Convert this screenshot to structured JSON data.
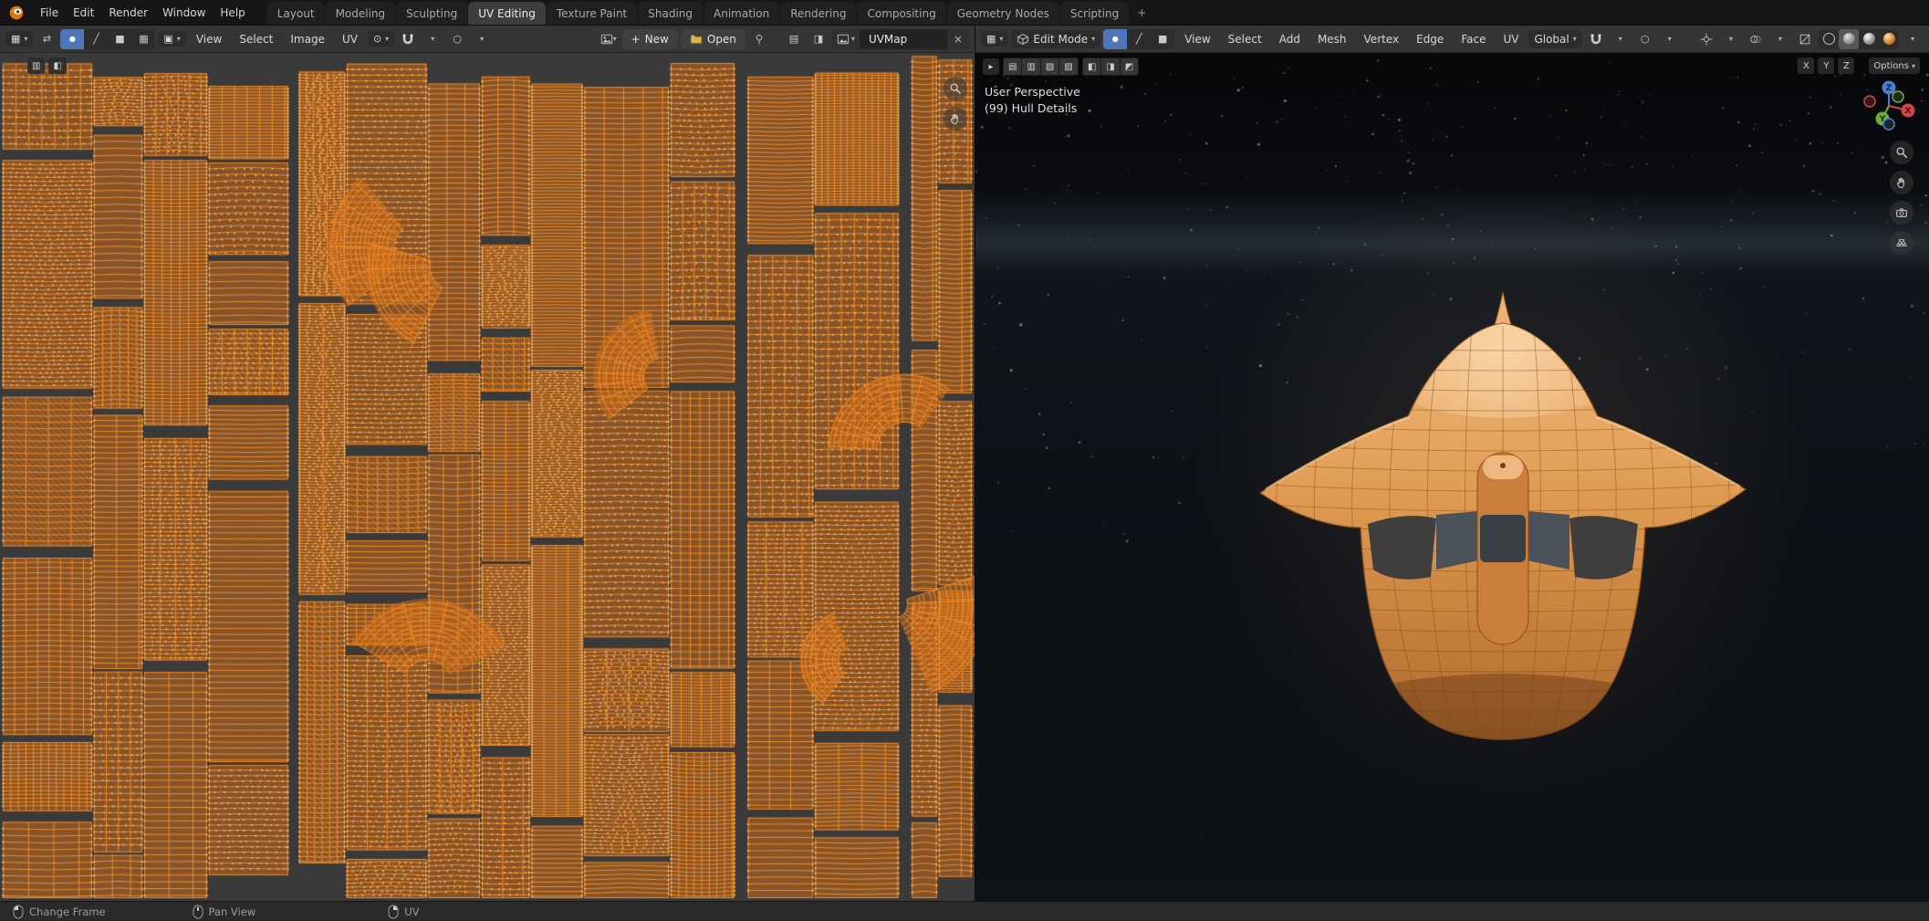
{
  "topbar": {
    "menus": {
      "file": "File",
      "edit": "Edit",
      "render": "Render",
      "window": "Window",
      "help": "Help"
    },
    "tabs": [
      "Layout",
      "Modeling",
      "Sculpting",
      "UV Editing",
      "Texture Paint",
      "Shading",
      "Animation",
      "Rendering",
      "Compositing",
      "Geometry Nodes",
      "Scripting"
    ],
    "add_tab": "+"
  },
  "uv_editor": {
    "menus": {
      "view": "View",
      "select": "Select",
      "image": "Image",
      "uv": "UV"
    },
    "new_label": "New",
    "open_label": "Open",
    "image_name": "UVMap"
  },
  "viewport": {
    "mode_label": "Edit Mode",
    "menus": {
      "view": "View",
      "select": "Select",
      "add": "Add",
      "mesh": "Mesh",
      "vertex": "Vertex",
      "edge": "Edge",
      "face": "Face",
      "uv": "UV"
    },
    "orientation": "Global",
    "axes": {
      "x": "X",
      "y": "Y",
      "z": "Z"
    },
    "options_label": "Options",
    "overlay": {
      "line1": "User Perspective",
      "line2": "(99) Hull Details"
    },
    "gizmo": {
      "x": "X",
      "y": "Y",
      "z": "Z"
    }
  },
  "statusbar": {
    "change_frame": "Change Frame",
    "pan_view": "Pan View",
    "uv": "UV"
  },
  "icons": {
    "dropdown": "▾",
    "play": "▸",
    "editor_grid": "▦",
    "vertex": "●",
    "edge": "╱",
    "face": "■",
    "island": "▦",
    "sync": "⇄",
    "sticky": "▣",
    "pivot": "⊙",
    "prop": "○",
    "plus": "+",
    "close": "×",
    "tool_a": "▤",
    "tool_b": "▥",
    "tool_c": "▧",
    "tool_d": "▨",
    "tool_e": "◧",
    "tool_f": "◨",
    "tool_g": "◩"
  },
  "colors": {
    "uv_bg": "#3a3a3a",
    "uv_face": "rgba(209,110,26,0.50)",
    "uv_edge": "rgba(246,142,38,0.95)",
    "uv_vertex": "#ffb45f",
    "accent": "#4f76b8",
    "ship_light": "#f2ba7c",
    "ship_mid": "#dd9850",
    "ship_dark": "#a96832"
  }
}
